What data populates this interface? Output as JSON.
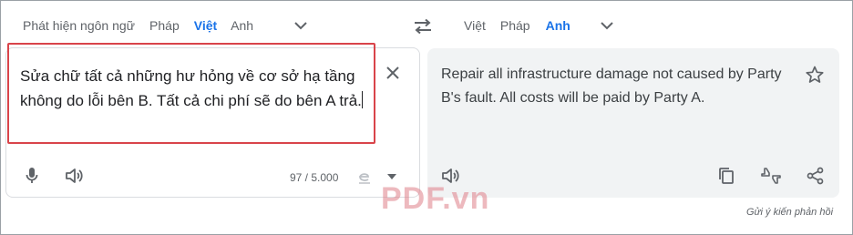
{
  "source_langs": {
    "tabs": [
      "Phát hiện ngôn ngữ",
      "Pháp",
      "Việt",
      "Anh"
    ],
    "active": "Việt",
    "more_icon": "chevron-down-icon"
  },
  "swap_icon": "swap-horiz-icon",
  "target_langs": {
    "tabs": [
      "Việt",
      "Pháp",
      "Anh"
    ],
    "active": "Anh",
    "more_icon": "chevron-down-icon"
  },
  "source": {
    "text": "Sửa chữ tất cả những hư hỏng về cơ sở hạ tầng không do lỗi bên B. Tất cả chi phí sẽ do bên A trả.",
    "char_count": "97 / 5.000",
    "icons": [
      "close-icon",
      "microphone-icon",
      "speaker-icon",
      "handwriting-icon",
      "caret-down-icon"
    ]
  },
  "target": {
    "text": "Repair all infrastructure damage not caused by Party B's fault. All costs will be paid by Party A.",
    "icons": [
      "star-icon",
      "speaker-icon",
      "copy-icon",
      "rate-icon",
      "share-icon"
    ]
  },
  "feedback_label": "Gửi ý kiến phản hồi",
  "watermark": "PDF.vn",
  "colors": {
    "accent": "#1a73e8",
    "highlight": "#d9444a",
    "panel": "#f1f3f4"
  }
}
